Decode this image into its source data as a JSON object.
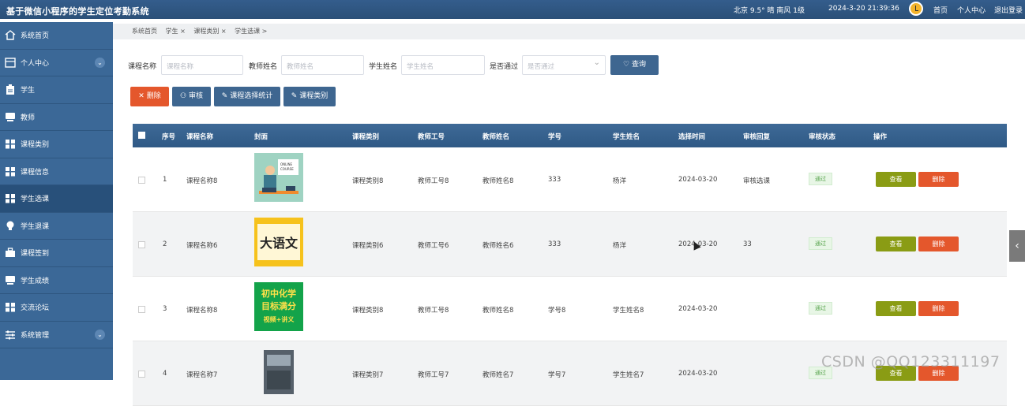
{
  "header": {
    "title": "基于微信小程序的学生定位考勤系统",
    "weather": "北京 9.5° 晴 南风 1级",
    "datetime": "2024-3-20 21:39:36",
    "nav": [
      "首页",
      "个人中心",
      "退出登录"
    ]
  },
  "sidebar": {
    "items": [
      {
        "label": "系统首页",
        "icon": "home-icon"
      },
      {
        "label": "个人中心",
        "icon": "window-icon",
        "expand": true
      },
      {
        "label": "学生",
        "icon": "clipboard-icon"
      },
      {
        "label": "教师",
        "icon": "monitor-icon"
      },
      {
        "label": "课程类别",
        "icon": "grid-icon"
      },
      {
        "label": "课程信息",
        "icon": "grid-icon"
      },
      {
        "label": "学生选课",
        "icon": "grid-icon",
        "active": true
      },
      {
        "label": "学生退课",
        "icon": "bulb-icon"
      },
      {
        "label": "课程签到",
        "icon": "briefcase-icon"
      },
      {
        "label": "学生成绩",
        "icon": "monitor-icon"
      },
      {
        "label": "交流论坛",
        "icon": "grid-icon"
      },
      {
        "label": "系统管理",
        "icon": "sliders-icon",
        "expand": true
      }
    ]
  },
  "breadcrumb": [
    "系统首页",
    "学生 ×",
    "课程类别 ×",
    "学生选课 >"
  ],
  "search": {
    "course_label": "课程名称",
    "course_placeholder": "课程名称",
    "teacher_label": "教师姓名",
    "teacher_placeholder": "教师姓名",
    "student_label": "学生姓名",
    "student_placeholder": "学生姓名",
    "pass_label": "是否通过",
    "pass_placeholder": "是否通过",
    "query_button": "♡ 查询"
  },
  "actions": {
    "delete": "✕ 删除",
    "audit": "⚇ 审核",
    "stats": "✎ 课程选择统计",
    "category": "✎ 课程类别"
  },
  "table": {
    "headers": [
      "序号",
      "课程名称",
      "封面",
      "课程类别",
      "教师工号",
      "教师姓名",
      "学号",
      "学生姓名",
      "选择时间",
      "审核回复",
      "审核状态",
      "操作"
    ],
    "view_label": "查看",
    "delete_label": "删除",
    "rows": [
      {
        "no": "1",
        "course": "课程名称8",
        "category": "课程类别8",
        "teacher_id": "教师工号8",
        "teacher_name": "教师姓名8",
        "student_id": "333",
        "student_name": "杨洋",
        "time": "2024-03-20",
        "reply": "审核选课",
        "status": "通过",
        "cover": "cover-online-course"
      },
      {
        "no": "2",
        "course": "课程名称6",
        "category": "课程类别6",
        "teacher_id": "教师工号6",
        "teacher_name": "教师姓名6",
        "student_id": "333",
        "student_name": "杨洋",
        "time": "2024-03-20",
        "reply": "33",
        "status": "通过",
        "cover": "cover-dayuwen",
        "cover_text": "大语文"
      },
      {
        "no": "3",
        "course": "课程名称8",
        "category": "课程类别8",
        "teacher_id": "教师工号8",
        "teacher_name": "教师姓名8",
        "student_id": "学号8",
        "student_name": "学生姓名8",
        "time": "2024-03-20",
        "reply": "",
        "status": "通过",
        "cover": "cover-chemistry",
        "cover_lines": [
          "初中化学",
          "目标满分",
          "视频+讲义"
        ]
      },
      {
        "no": "4",
        "course": "课程名称7",
        "category": "课程类别7",
        "teacher_id": "教师工号7",
        "teacher_name": "教师姓名7",
        "student_id": "学号7",
        "student_name": "学生姓名7",
        "time": "2024-03-20",
        "reply": "",
        "status": "通过",
        "cover": "cover-book"
      }
    ]
  },
  "watermark": "CSDN @QQ123311197",
  "colors": {
    "header": "#2f5783",
    "sidebar": "#3b6897",
    "view": "#8a9c14",
    "delete": "#e4572c",
    "pass_tag": "#5aa650"
  }
}
